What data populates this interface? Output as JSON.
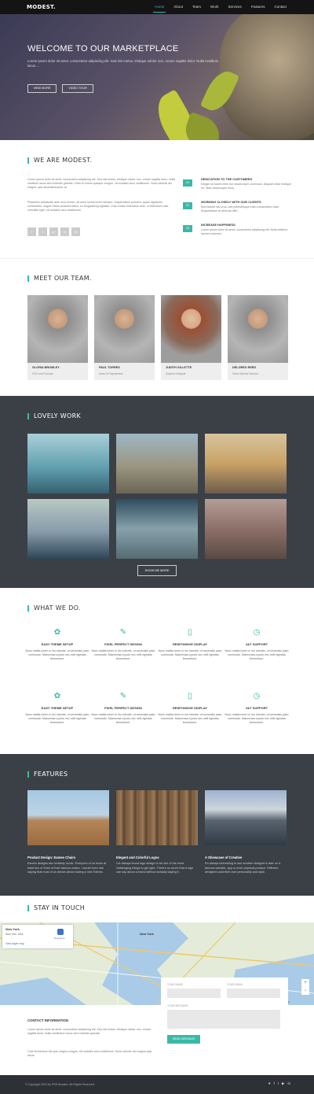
{
  "nav": {
    "logo": "MODEST.",
    "items": [
      "Home",
      "About",
      "Team",
      "Work",
      "Services",
      "Features",
      "Contact"
    ]
  },
  "hero": {
    "title": "WELCOME TO OUR MARKETPLACE",
    "text": "Lorem ipsum dolor sit amet, consectetur adipiscing elit. Sed nisi metus, tristique ndolor non, ornare sagittis dolor. Nulla vestibulu lacus ...",
    "btn_view": "VIEW MORE",
    "btn_video": "VIDEO TOUR"
  },
  "about": {
    "title": "WE ARE MODEST.",
    "p1": "Lorem ipsum dolor sit amet, consectetur adipiscing elit. Sed nisi metus, tristique ndolor non, ornare sagittis dolor. Nulla vestibulu lacus sed molestie gravida. Crferrm entum quisque congue, vel sodales arcu vestibulum. Nunc lobortis dui magna, quis lacusllamcorper at.",
    "p2": "Phasellus sollicitudin ante eros ornare, sit amet luctus lorem semper. Suspendisse posuere, quam dignissim consectetur, augue metus pharetra tellus, eu feugiatloreg egestist. Cras ornare bibendum ante, ut bibendum odio convallis eget, vel sodales arcu vestibulum.",
    "social": [
      "f",
      "t",
      "g+",
      "in",
      "be"
    ],
    "features": [
      {
        "num": "01",
        "title": "DEDICATION TO THE CUSTOMERS",
        "text": "Integer sit locerit mine dor ullamcorper commodo. Aliquam vitae tristique mi, vitae ullamcorper risus."
      },
      {
        "num": "02",
        "title": "WORKING CLOSELY WITH OUR CLIENTS",
        "text": "Sed blandit nisi urna, sed pellentesque enim consectetur vitae. Suspendisse at vehicula nibh."
      },
      {
        "num": "03",
        "title": "INCREASE HAPPINESS",
        "text": "Lorem ipsum dolor sit amet, consectetur adipiscing elit. Nulla eleifend laoreet euismod."
      }
    ]
  },
  "team": {
    "title": "MEET OUR TEAM.",
    "members": [
      {
        "name": "GLORIA BROMLEY",
        "role": "CEO and Founder"
      },
      {
        "name": "PAUL TORRES",
        "role": "Head Of Department"
      },
      {
        "name": "JUDITH GILLETTE",
        "role": "Graphic Designer"
      },
      {
        "name": "DELORED REED",
        "role": "Client Service Director"
      }
    ]
  },
  "work": {
    "title": "LOVELY WORK",
    "button": "SHOW ME MORE",
    "tiles": [
      "#6fa4b2",
      "#8c8f7e",
      "#c8a269",
      "#7c96a8",
      "#4e6470",
      "#8c6f67"
    ]
  },
  "services": {
    "title": "WHAT WE DO.",
    "items": [
      {
        "icon": "palette-icon",
        "title": "EASY THEME SETUP",
        "text": "Nunc mattis lorem in leo lobortis, ut venenatis justo commodo. Maecenas a justo nec velit egestas fermentum."
      },
      {
        "icon": "pencil-icon",
        "title": "PIXEL PERFECT DESIGN",
        "text": "Nunc mattis lorem in leo lobortis, ut venenatis justo commodo. Maecenas a justo nec velit egestas fermentum."
      },
      {
        "icon": "mobile-icon",
        "title": "RESPONSIVE DISPLAY",
        "text": "Nunc mattis lorem in leo lobortis, ut venenatis justo commodo. Maecenas a justo nec velit egestas fermentum."
      },
      {
        "icon": "clock-icon",
        "title": "24/7 SUPPORT",
        "text": "Nunc mattis lorem in leo lobortis, ut venenatis justo commodo. Maecenas a justo nec velit egestas fermentum."
      }
    ]
  },
  "features": {
    "title": "FEATURES",
    "items": [
      {
        "title": "Product Design: Eames Chairs",
        "text": "Eames designs are certainly iconic. Everyone of us know at least two or three of their famous chairs. I would even risk saying that most of us dream about having a nice Eames."
      },
      {
        "title": "Elegant and Colorful Logos",
        "text": "I've always found logo design to be one of the most challenging things to get right. There's so much that a logo can say about a brand without actually saying it."
      },
      {
        "title": "A Showcase of Creative",
        "text": "It's always interesting to see another designer's take on a famous website, app or even physical product. Different designers add their own personality and style."
      }
    ]
  },
  "contact": {
    "title": "STAY IN TOUCH",
    "map_city": "New York",
    "map_region": "New York, USA",
    "map_link": "View larger map",
    "map_directions": "Directions",
    "map_label": "New York",
    "map_credit": "Map data ©2014 Google",
    "form_name": "YOUR NAME",
    "form_email": "YOUR EMAIL",
    "form_message": "YOUR MESSAGE",
    "form_send": "SEND MESSAGE",
    "info_title": "CONTACT INFORMATION",
    "info_p1": "Lorem ipsum dolor sit amet, consectetur adipiscing elit. Sed nisi metus, tristique ndolor non, ornare sagittis dolor. Nulla vestibulum lacus sed molestie gravida.",
    "info_p2": "Cras fermentum elit quis magna congue, vel sodales arcu vestibulum. Nunc lobortis dui magna quis lacus."
  },
  "footer": {
    "copyright": "© Copyright 2014 by PSD Booster. All Rights Reserved.",
    "social": [
      "♥",
      "f",
      "t",
      "▶",
      "in"
    ]
  }
}
